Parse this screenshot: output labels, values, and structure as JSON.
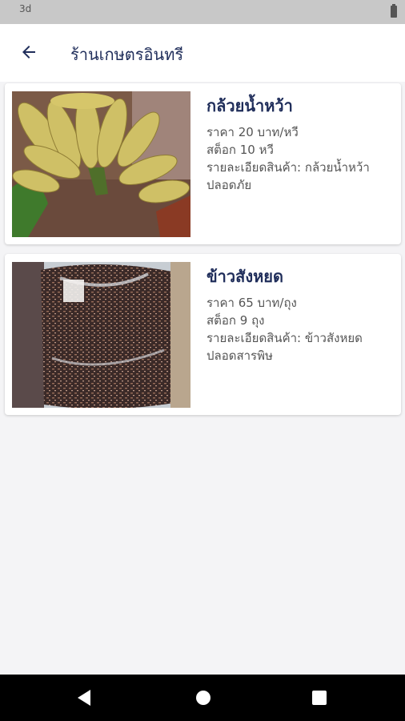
{
  "status_bar": {
    "time": "3d"
  },
  "app_bar": {
    "title": "ร้านเกษตรอินทรี"
  },
  "products": [
    {
      "name": "กล้วยน้ำหว้า",
      "price": "ราคา 20 บาท/หวี",
      "stock": "สต็อก 10 หวี",
      "detail": "รายละเอียดสินค้า: กล้วยน้ำหว้า ปลอดภัย",
      "image": "banana-bunch-photo"
    },
    {
      "name": "ข้าวสังหยด",
      "price": "ราคา 65 บาท/ถุง",
      "stock": "สต็อก 9 ถุง",
      "detail": "รายละเอียดสินค้า: ข้าวสังหยด ปลอดสารพิษ",
      "image": "rice-bag-photo"
    }
  ],
  "icons": {
    "back": "arrow-left-icon",
    "nav_back": "triangle-back-icon",
    "nav_home": "circle-home-icon",
    "nav_recent": "square-recent-icon"
  },
  "colors": {
    "title": "#1f2d5a",
    "background": "#f4f4f6"
  }
}
